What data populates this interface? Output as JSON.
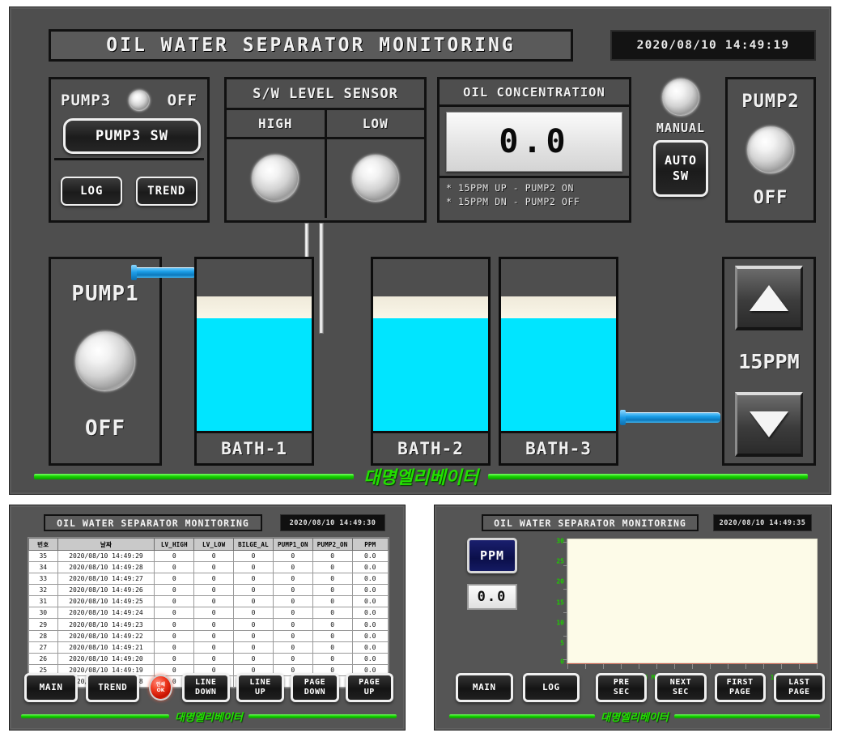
{
  "main": {
    "title": "OIL WATER SEPARATOR MONITORING",
    "clock": "2020/08/10 14:49:19",
    "pump3": {
      "label": "PUMP3",
      "state": "OFF",
      "lamp": "indicator-lamp",
      "sw_label": "PUMP3 SW",
      "log_label": "LOG",
      "trend_label": "TREND"
    },
    "level_sensor": {
      "title": "S/W LEVEL SENSOR",
      "high_label": "HIGH",
      "low_label": "LOW"
    },
    "oil_concentration": {
      "title": "OIL CONCENTRATION",
      "value": "0.0",
      "note1": "* 15PPM UP - PUMP2 ON",
      "note2": "* 15PPM DN - PUMP2 OFF"
    },
    "mode": {
      "manual_label": "MANUAL",
      "auto_line1": "AUTO",
      "auto_line2": "SW"
    },
    "pump2": {
      "label": "PUMP2",
      "state": "OFF"
    },
    "pump1": {
      "label": "PUMP1",
      "state": "OFF"
    },
    "baths": [
      {
        "label": "BATH-1"
      },
      {
        "label": "BATH-2"
      },
      {
        "label": "BATH-3"
      }
    ],
    "ppm_setpoint": {
      "up_icon": "triangle-up-icon",
      "value": "15PPM",
      "down_icon": "triangle-down-icon"
    },
    "brand": "대명엘리베이터"
  },
  "log_screen": {
    "title": "OIL WATER SEPARATOR MONITORING",
    "clock": "2020/08/10 14:49:30",
    "columns": [
      "번호",
      "날짜",
      "LV_HIGH",
      "LV_LOW",
      "BILGE_AL",
      "PUMP1_ON",
      "PUMP2_ON",
      "PPM"
    ],
    "rows": [
      [
        "35",
        "2020/08/10 14:49:29",
        "0",
        "0",
        "0",
        "0",
        "0",
        "0.0"
      ],
      [
        "34",
        "2020/08/10 14:49:28",
        "0",
        "0",
        "0",
        "0",
        "0",
        "0.0"
      ],
      [
        "33",
        "2020/08/10 14:49:27",
        "0",
        "0",
        "0",
        "0",
        "0",
        "0.0"
      ],
      [
        "32",
        "2020/08/10 14:49:26",
        "0",
        "0",
        "0",
        "0",
        "0",
        "0.0"
      ],
      [
        "31",
        "2020/08/10 14:49:25",
        "0",
        "0",
        "0",
        "0",
        "0",
        "0.0"
      ],
      [
        "30",
        "2020/08/10 14:49:24",
        "0",
        "0",
        "0",
        "0",
        "0",
        "0.0"
      ],
      [
        "29",
        "2020/08/10 14:49:23",
        "0",
        "0",
        "0",
        "0",
        "0",
        "0.0"
      ],
      [
        "28",
        "2020/08/10 14:49:22",
        "0",
        "0",
        "0",
        "0",
        "0",
        "0.0"
      ],
      [
        "27",
        "2020/08/10 14:49:21",
        "0",
        "0",
        "0",
        "0",
        "0",
        "0.0"
      ],
      [
        "26",
        "2020/08/10 14:49:20",
        "0",
        "0",
        "0",
        "0",
        "0",
        "0.0"
      ],
      [
        "25",
        "2020/08/10 14:49:19",
        "0",
        "0",
        "0",
        "0",
        "0",
        "0.0"
      ],
      [
        "24",
        "2020/08/10 14:49:18",
        "0",
        "0",
        "0",
        "0",
        "0",
        "0.0"
      ]
    ],
    "buttons": {
      "main": "MAIN",
      "trend": "TREND",
      "print_line1": "인쇄",
      "print_line2": "OK",
      "line_down_1": "LINE",
      "line_down_2": "DOWN",
      "line_up_1": "LINE",
      "line_up_2": "UP",
      "page_down_1": "PAGE",
      "page_down_2": "DOWN",
      "page_up_1": "PAGE",
      "page_up_2": "UP"
    },
    "brand": "대명엘리베이터"
  },
  "trend_screen": {
    "title": "OIL WATER SEPARATOR MONITORING",
    "clock": "2020/08/10 14:49:35",
    "ppm_button": "PPM",
    "ppm_value": "0.0",
    "buttons": {
      "main": "MAIN",
      "log": "LOG",
      "pre_sec_1": "PRE",
      "pre_sec_2": "SEC",
      "next_sec_1": "NEXT",
      "next_sec_2": "SEC",
      "first_page_1": "FIRST",
      "first_page_2": "PAGE",
      "last_page_1": "LAST",
      "last_page_2": "PAGE"
    },
    "brand": "대명엘리베이터"
  },
  "chart_data": {
    "type": "line",
    "title": "OIL WATER SEPARATOR MONITORING",
    "xlabel": "",
    "ylabel": "PPM",
    "x": [
      "6 MIN",
      "5 MIN",
      "4 MIN",
      "3 MIN",
      "2 MIN",
      "1 MIN",
      "0 MIN"
    ],
    "y_ticks": [
      "30",
      "25",
      "20",
      "15",
      "10",
      "5",
      "0"
    ],
    "ylim": [
      0,
      30
    ],
    "series": [
      {
        "name": "PPM",
        "values": [
          0,
          0,
          0,
          0,
          0,
          0,
          0
        ]
      }
    ],
    "grid": false,
    "legend": "none",
    "plot_background": "#fdfbe8",
    "axis_color": "#1ecb00"
  }
}
